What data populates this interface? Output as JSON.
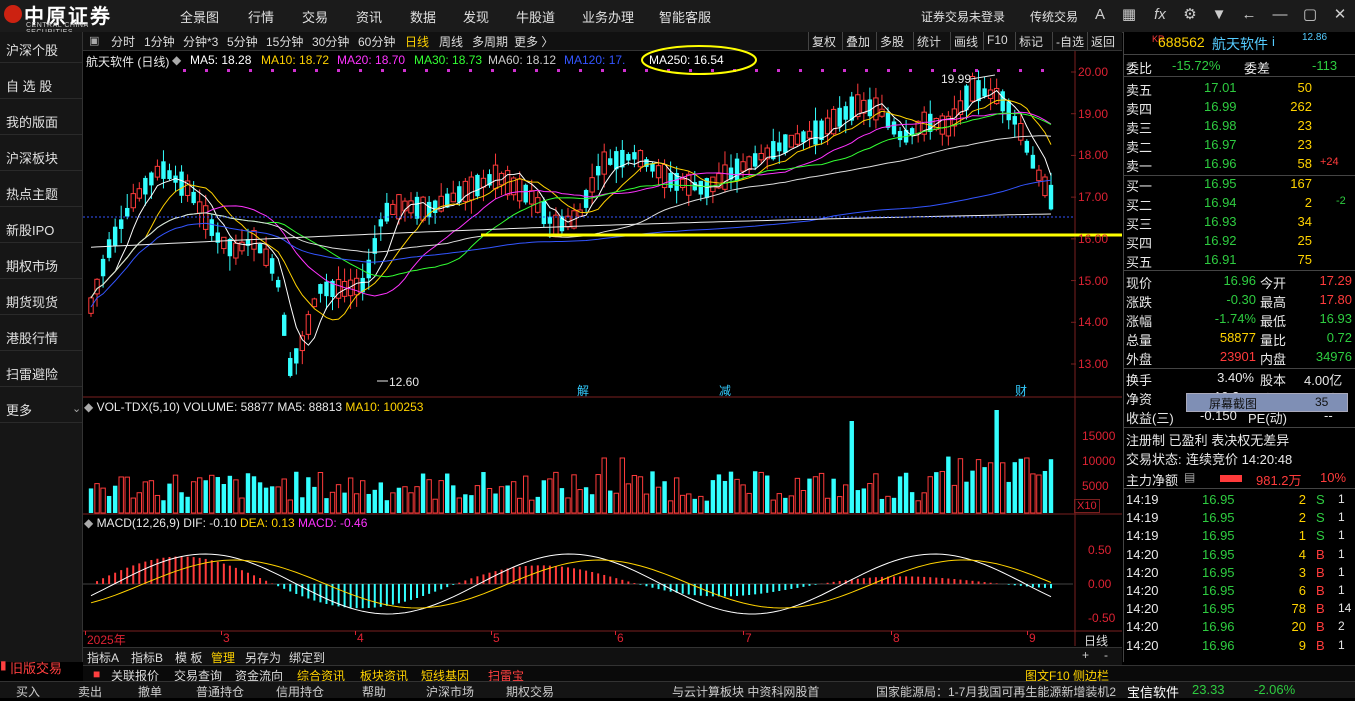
{
  "header": {
    "logo_cn": "中原证券",
    "logo_en": "CENTRAL CHINA SECURITIES",
    "menu": [
      "全景图",
      "行情",
      "交易",
      "资讯",
      "数据",
      "发现",
      "牛股道",
      "业务办理",
      "智能客服"
    ],
    "login_status": "证券交易未登录",
    "mode": "传统交易",
    "icons": [
      "font-size-icon",
      "grid-icon",
      "fx-icon",
      "gear-icon",
      "shirt-icon",
      "back-arrow-icon",
      "minimize-icon",
      "restore-icon",
      "close-icon"
    ]
  },
  "leftnav": {
    "items": [
      "沪深个股",
      "自 选 股",
      "我的版面",
      "沪深板块",
      "热点主题",
      "新股IPO",
      "期权市场",
      "期货现货",
      "港股行情",
      "扫雷避险",
      "更多"
    ],
    "old_trade": "旧版交易"
  },
  "periodbar": {
    "periods": [
      "分时",
      "1分钟",
      "分钟*3",
      "5分钟",
      "15分钟",
      "30分钟",
      "60分钟",
      "日线",
      "周线",
      "多周期",
      "更多 〉"
    ],
    "active": "日线",
    "right_buttons": [
      "复权",
      "叠加",
      "多股",
      "统计",
      "画线",
      "F10",
      "标记",
      "-自选",
      "返回"
    ]
  },
  "main_chart": {
    "title": "航天软件 (日线)",
    "ma": [
      {
        "label": "MA5: 18.28",
        "color": "#ffffff"
      },
      {
        "label": "MA10: 18.72",
        "color": "#ffd200"
      },
      {
        "label": "MA20: 18.70",
        "color": "#ff33ff"
      },
      {
        "label": "MA30: 18.73",
        "color": "#33ff33"
      },
      {
        "label": "MA60: 18.12",
        "color": "#cccccc"
      },
      {
        "label": "MA120: 17.",
        "color": "#3355ff"
      },
      {
        "label": "MA250: 16.54",
        "color": "#ffffff"
      }
    ],
    "high_label": "19.99",
    "low_label": "12.60",
    "events": [
      "解",
      "减",
      "财"
    ],
    "y_ticks": [
      "20.00",
      "19.00",
      "18.00",
      "17.00",
      "16.00",
      "15.00",
      "14.00",
      "13.00"
    ],
    "colors": {
      "up": "#ff3b3b",
      "down": "#33ffff",
      "ma5": "#ffffff",
      "ma10": "#ffd200",
      "ma20": "#ff33ff",
      "ma30": "#33ff33",
      "ma60": "#dddddd",
      "ma120": "#3355ff",
      "support": "#ffff00",
      "highlight": "#ffff00"
    }
  },
  "volume_chart": {
    "title": "VOL-TDX(5,10)",
    "volume": "VOLUME: 58877",
    "ma5": "MA5: 88813",
    "ma10": "MA10: 100253",
    "y_ticks": [
      "15000",
      "10000",
      "5000"
    ],
    "unit": "X10"
  },
  "macd_chart": {
    "title": "MACD(12,26,9)",
    "dif": "DIF: -0.10",
    "dea": "DEA: 0.13",
    "macd": "MACD: -0.46",
    "y_ticks": [
      "0.50",
      "0.00",
      "-0.50"
    ]
  },
  "xaxis": {
    "labels": [
      "2025年",
      "3",
      "4",
      "5",
      "6",
      "7",
      "8",
      "9"
    ],
    "period": "日线"
  },
  "tabs": {
    "items": [
      "指标A",
      "指标B",
      "模 板",
      "管理",
      "另存为",
      "绑定到"
    ],
    "active": "管理"
  },
  "infobar": {
    "items": [
      "关联报价",
      "交易查询",
      "资金流向",
      "综合资讯",
      "板块资讯",
      "短线基因",
      "扫雷宝"
    ],
    "right": [
      "图文F10",
      "侧边栏"
    ]
  },
  "bottombar": {
    "items": [
      "买入",
      "卖出",
      "撤单",
      "普通持仓",
      "信用持仓",
      "帮助",
      "沪深市场",
      "期权交易"
    ],
    "news": "与云计算板块   中资科网股首",
    "news2": "国家能源局：1-7月我国可再生能源新增装机2",
    "ticker_name": "宝信软件",
    "ticker_price": "23.33",
    "ticker_change": "-2.06%"
  },
  "quote": {
    "market": "KR",
    "code": "688562",
    "name": "航天软件",
    "name_suffix": "i",
    "corner": "12.86",
    "weibi_label": "委比",
    "weibi": "-15.72%",
    "weicha_label": "委差",
    "weicha": "-113",
    "asks": [
      {
        "label": "卖五",
        "price": "17.01",
        "vol": "50",
        "chg": ""
      },
      {
        "label": "卖四",
        "price": "16.99",
        "vol": "262",
        "chg": ""
      },
      {
        "label": "卖三",
        "price": "16.98",
        "vol": "23",
        "chg": ""
      },
      {
        "label": "卖二",
        "price": "16.97",
        "vol": "23",
        "chg": ""
      },
      {
        "label": "卖一",
        "price": "16.96",
        "vol": "58",
        "chg": "+24"
      }
    ],
    "bids": [
      {
        "label": "买一",
        "price": "16.95",
        "vol": "167",
        "chg": ""
      },
      {
        "label": "买二",
        "price": "16.94",
        "vol": "2",
        "chg": "-2"
      },
      {
        "label": "买三",
        "price": "16.93",
        "vol": "34",
        "chg": ""
      },
      {
        "label": "买四",
        "price": "16.92",
        "vol": "25",
        "chg": ""
      },
      {
        "label": "买五",
        "price": "16.91",
        "vol": "75",
        "chg": ""
      }
    ],
    "stats": [
      {
        "l1": "现价",
        "v1": "16.96",
        "c1": "green",
        "l2": "今开",
        "v2": "17.29",
        "c2": "red"
      },
      {
        "l1": "涨跌",
        "v1": "-0.30",
        "c1": "green",
        "l2": "最高",
        "v2": "17.80",
        "c2": "red"
      },
      {
        "l1": "涨幅",
        "v1": "-1.74%",
        "c1": "green",
        "l2": "最低",
        "v2": "16.93",
        "c2": "green"
      },
      {
        "l1": "总量",
        "v1": "58877",
        "c1": "yellow",
        "l2": "量比",
        "v2": "0.72",
        "c2": "green"
      },
      {
        "l1": "外盘",
        "v1": "23901",
        "c1": "red",
        "l2": "内盘",
        "v2": "34976",
        "c2": "green"
      }
    ],
    "turnover_label": "换手",
    "turnover": "3.40%",
    "equity_label": "股本",
    "equity": "4.00亿",
    "net_label": "净资",
    "net": "10.3",
    "circ_label": "流通",
    "circ": "1.73亿",
    "income_label": "收益(三)",
    "income": "-0.150",
    "pe_label": "PE(动)",
    "pe": "--",
    "screenshot_tooltip": "屏幕截图",
    "screenshot_num": "35",
    "tags": "注册制 已盈利 表决权无差异",
    "trade_status_label": "交易状态:",
    "trade_status": "连续竞价 14:20:48",
    "mainflow_label": "主力净额",
    "mainflow": "981.2万",
    "mainflow_pct": "10%",
    "ticks": [
      {
        "t": "14:19",
        "p": "16.95",
        "v": "2",
        "s": "S",
        "x": "1"
      },
      {
        "t": "14:19",
        "p": "16.95",
        "v": "2",
        "s": "S",
        "x": "1"
      },
      {
        "t": "14:19",
        "p": "16.95",
        "v": "1",
        "s": "S",
        "x": "1"
      },
      {
        "t": "14:20",
        "p": "16.95",
        "v": "4",
        "s": "B",
        "x": "1"
      },
      {
        "t": "14:20",
        "p": "16.95",
        "v": "3",
        "s": "B",
        "x": "1"
      },
      {
        "t": "14:20",
        "p": "16.95",
        "v": "6",
        "s": "B",
        "x": "1"
      },
      {
        "t": "14:20",
        "p": "16.95",
        "v": "78",
        "s": "B",
        "x": "14"
      },
      {
        "t": "14:20",
        "p": "16.96",
        "v": "20",
        "s": "B",
        "x": "2"
      },
      {
        "t": "14:20",
        "p": "16.96",
        "v": "9",
        "s": "B",
        "x": "1"
      }
    ]
  }
}
